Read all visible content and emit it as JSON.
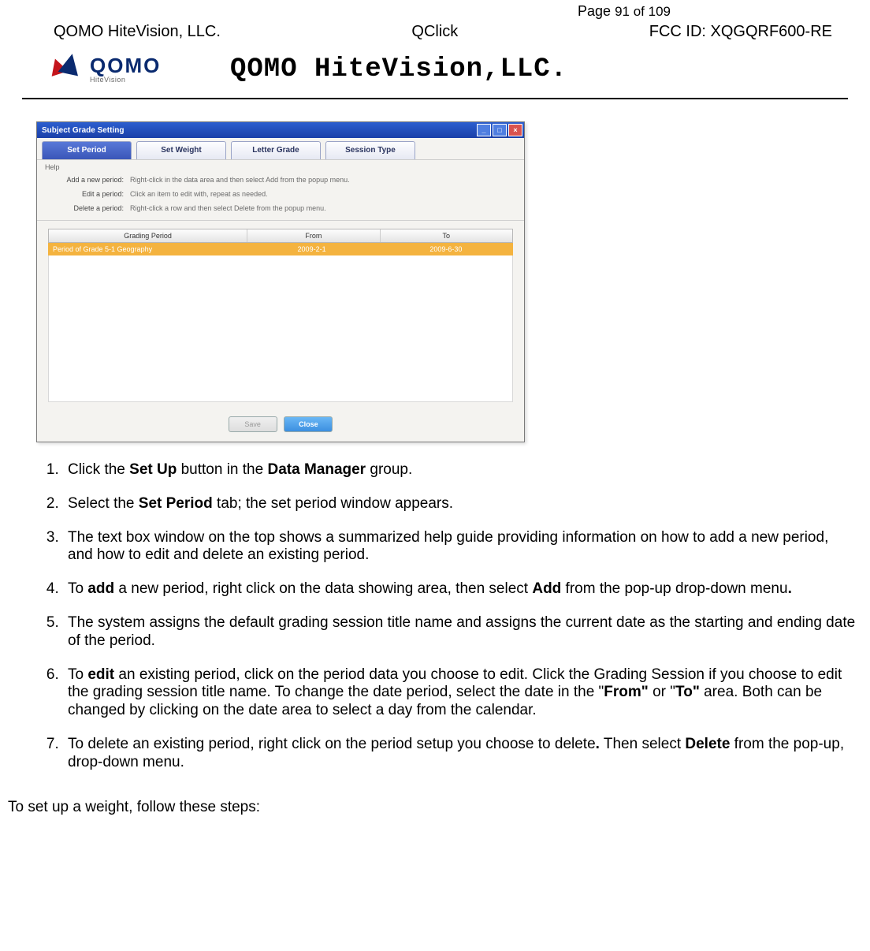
{
  "header": {
    "page_label_prefix": "Page ",
    "page_current": "91",
    "page_of": " of ",
    "page_total": "109",
    "company": "QOMO HiteVision, LLC.",
    "product": "QClick",
    "fcc": "FCC ID: XQGQRF600-RE",
    "brand_title": "QOMO HiteVision,LLC.",
    "logo_text": "QOMO",
    "logo_sub": "HiteVision"
  },
  "window": {
    "title": "Subject Grade Setting",
    "tabs": [
      "Set Period",
      "Set Weight",
      "Letter Grade",
      "Session Type"
    ],
    "active_tab_index": 0,
    "help_title": "Help",
    "help": [
      {
        "label": "Add a new period:",
        "desc": "Right-click in the data area and then select Add from the popup menu."
      },
      {
        "label": "Edit a period:",
        "desc": "Click an item to edit with, repeat as needed."
      },
      {
        "label": "Delete a period:",
        "desc": "Right-click a row and then select Delete from the popup menu."
      }
    ],
    "columns": [
      "Grading Period",
      "From",
      "To"
    ],
    "row": {
      "name": "Period of Grade 5-1 Geography",
      "from": "2009-2-1",
      "to": "2009-6-30"
    },
    "buttons": {
      "save": "Save",
      "close": "Close"
    }
  },
  "steps": {
    "s1a": "Click the ",
    "s1b": "Set Up",
    "s1c": " button in the ",
    "s1d": "Data Manager",
    "s1e": " group.",
    "s2a": "Select the ",
    "s2b": "Set Period",
    "s2c": " tab; the set period window appears.",
    "s3": "The text box window on the top shows a summarized help guide providing information on how to add a new period, and how to edit and delete an existing period.",
    "s4a": "To ",
    "s4b": "add",
    "s4c": " a new period, right click on the data showing area, then select ",
    "s4d": "Add",
    "s4e": " from the pop-up drop-down menu",
    "s4f": ".",
    "s5": "The system assigns the default grading session title name and assigns the current date as the starting and ending date of the period.",
    "s6a": "To ",
    "s6b": "edit",
    "s6c": " an existing period, click on the period data you choose to edit. Click the Grading Session if you choose to edit the grading session title name. To change the date period, select the date in the \"",
    "s6d": "From\"",
    "s6e": " or \"",
    "s6f": "To\"",
    "s6g": " area. Both can be changed by clicking on the date area to select a day from the calendar.",
    "s7a": "To delete an existing period, right click on the period setup you choose to delete",
    "s7b": ".",
    "s7c": " Then select ",
    "s7d": "Delete",
    "s7e": " from the pop-up, drop-down menu.",
    "closing": "To set up a weight, follow these steps:"
  }
}
